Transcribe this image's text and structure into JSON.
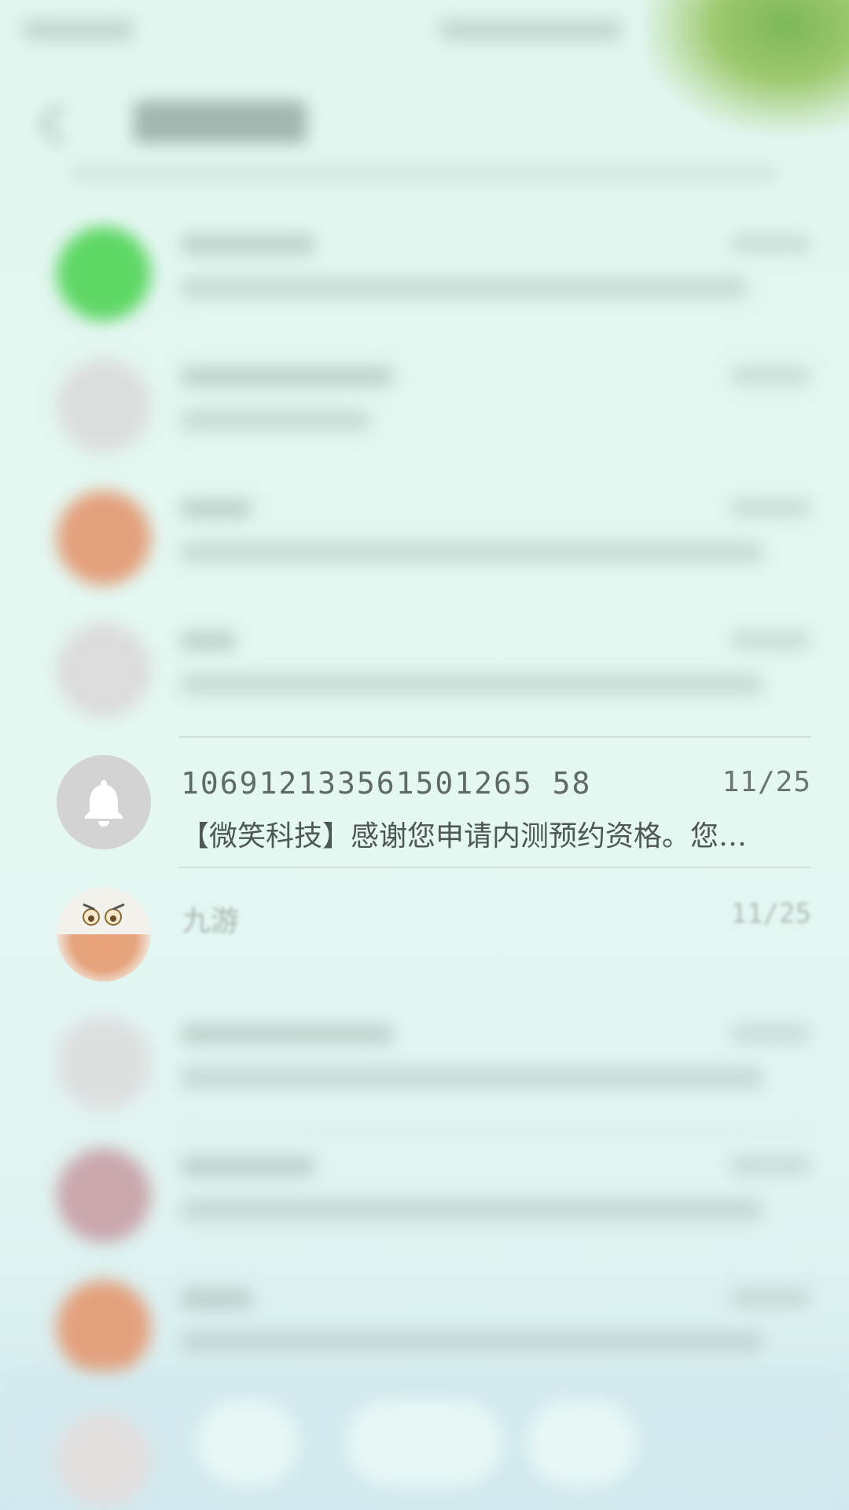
{
  "focused_conversation": {
    "sender": "106912133561501265 58",
    "time": "11/25",
    "snippet": "【微笑科技】感谢您申请内测预约资格。您…",
    "avatar_icon": "bell-icon",
    "avatar_color": "#d3d3d3"
  },
  "next_conversation": {
    "name": "九游",
    "time": "11/25"
  },
  "colors": {
    "background": "#e2f6f0",
    "text_primary": "#4d5753",
    "text_secondary": "#6a7570",
    "divider": "#cfe0db"
  }
}
